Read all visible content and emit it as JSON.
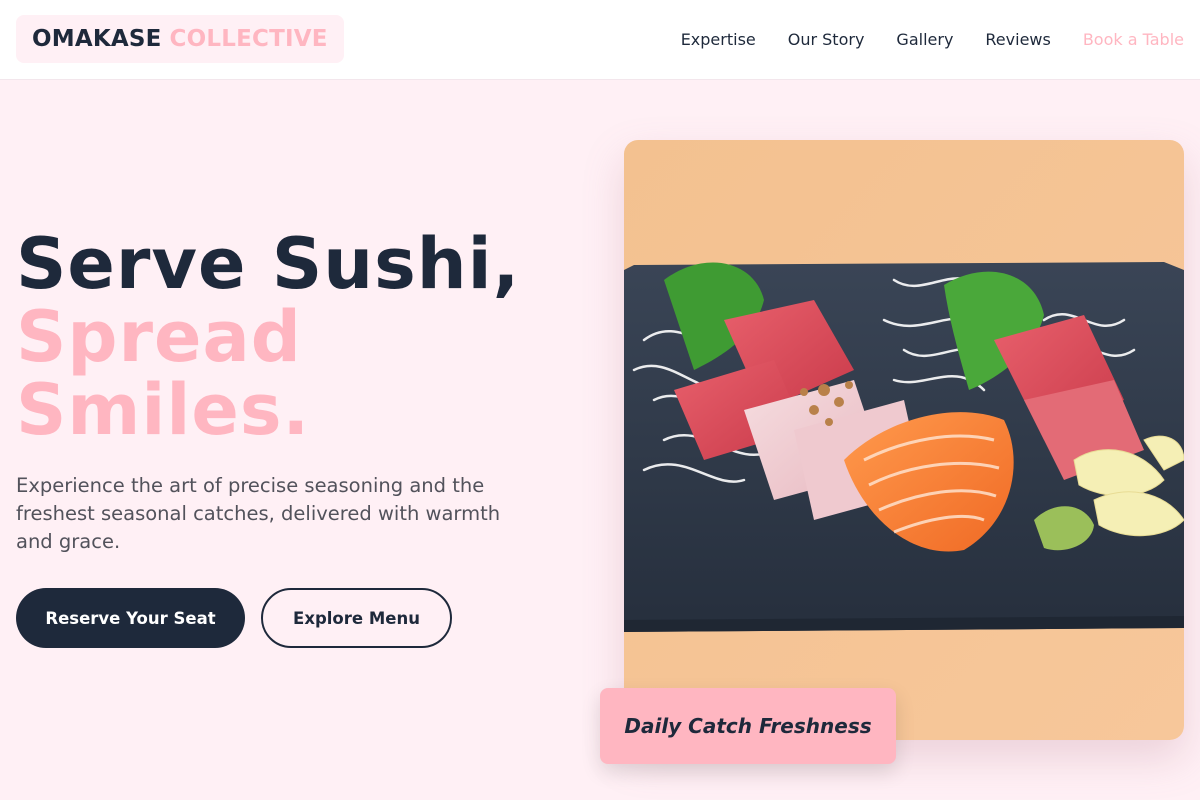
{
  "brand": {
    "name_part1": "OMAKASE",
    "name_part2": "COLLECTIVE"
  },
  "nav": {
    "items": [
      {
        "label": "Expertise"
      },
      {
        "label": "Our Story"
      },
      {
        "label": "Gallery"
      },
      {
        "label": "Reviews"
      }
    ],
    "cta_label": "Book a Table"
  },
  "hero": {
    "title_line1": "Serve Sushi,",
    "title_line2": "Spread",
    "title_line3": "Smiles.",
    "subtitle": "Experience the art of precise seasoning and the freshest seasonal catches, delivered with warmth and grace.",
    "primary_button": "Reserve Your Seat",
    "secondary_button": "Explore Menu",
    "badge": "Daily Catch Freshness"
  },
  "colors": {
    "accent_pink": "#ffb6c1",
    "navy": "#1e293b",
    "page_background": "#fff0f5"
  },
  "image": {
    "subject": "sashimi-platter-photo"
  }
}
